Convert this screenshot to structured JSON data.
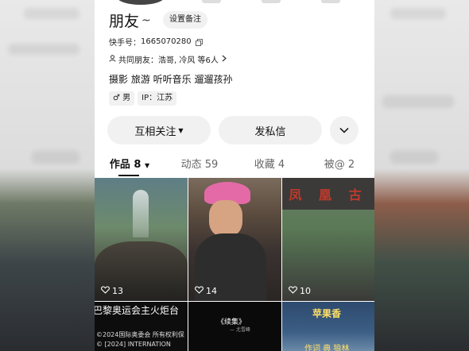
{
  "profile": {
    "name": "朋友",
    "name_suffix": "~",
    "remark_button": "设置备注",
    "id_label": "快手号：",
    "id_value": "1665070280",
    "mutual_label": "共同朋友：",
    "mutual_value": "浩哥, 冷风 等6人",
    "bio": "摄影 旅游 听听音乐 遛遛孩孙",
    "gender": "男",
    "ip": "IP：江苏"
  },
  "actions": {
    "follow": "互相关注",
    "message": "发私信"
  },
  "tabs": [
    {
      "label": "作品 8"
    },
    {
      "label": "动态 59"
    },
    {
      "label": "收藏 4"
    },
    {
      "label": "被@ 2"
    }
  ],
  "posts": [
    {
      "likes": "13",
      "caption": "巴黎奥运会主火炬台",
      "subcaption": "©2024国际奥委会 所有权利保",
      "subcaption2": "© [2024] INTERNATION"
    },
    {
      "likes": "14",
      "caption": "《续集》",
      "subcaption": "— 尤雪峰"
    },
    {
      "likes": "10",
      "sign": "凤 凰 古",
      "caption": "苹果香",
      "subcaption": "作词 典 狼林"
    }
  ],
  "colors": {
    "accent": "#111111",
    "chip": "#f1f1f1"
  }
}
